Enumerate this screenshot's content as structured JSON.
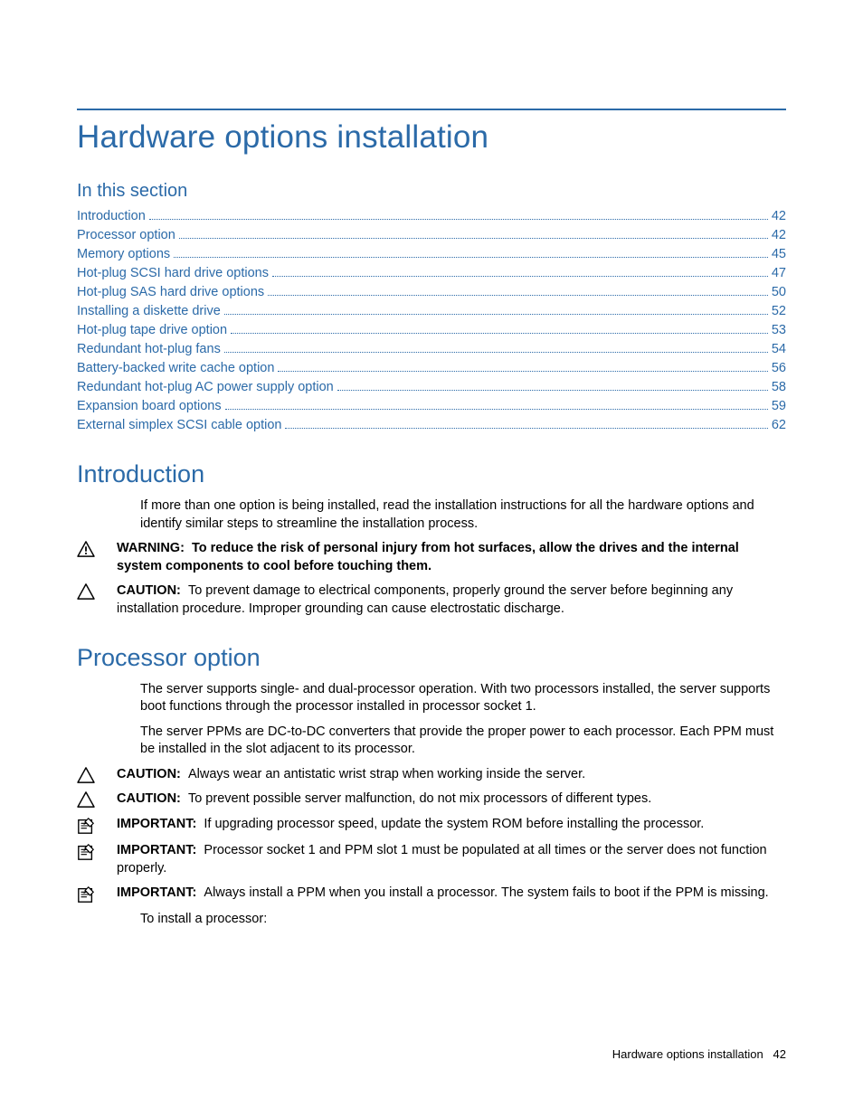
{
  "page_title": "Hardware options installation",
  "in_this_section_label": "In this section",
  "toc": [
    {
      "label": "Introduction",
      "page": "42"
    },
    {
      "label": "Processor option",
      "page": "42"
    },
    {
      "label": "Memory options",
      "page": "45"
    },
    {
      "label": "Hot-plug SCSI hard drive options",
      "page": "47"
    },
    {
      "label": "Hot-plug SAS hard drive options",
      "page": "50"
    },
    {
      "label": "Installing a diskette drive",
      "page": "52"
    },
    {
      "label": "Hot-plug tape drive option",
      "page": "53"
    },
    {
      "label": "Redundant hot-plug fans",
      "page": "54"
    },
    {
      "label": "Battery-backed write cache option",
      "page": "56"
    },
    {
      "label": "Redundant hot-plug AC power supply option",
      "page": "58"
    },
    {
      "label": "Expansion board options",
      "page": "59"
    },
    {
      "label": "External simplex SCSI cable option",
      "page": "62"
    }
  ],
  "introduction": {
    "heading": "Introduction",
    "body": "If more than one option is being installed, read the installation instructions for all the hardware options and identify similar steps to streamline the installation process.",
    "warning_label": "WARNING:",
    "warning_text": "To reduce the risk of personal injury from hot surfaces, allow the drives and the internal system components to cool before touching them.",
    "caution_label": "CAUTION:",
    "caution_text": "To prevent damage to electrical components, properly ground the server before beginning any installation procedure. Improper grounding can cause electrostatic discharge."
  },
  "processor": {
    "heading": "Processor option",
    "body1": "The server supports single- and dual-processor operation. With two processors installed, the server supports boot functions through the processor installed in processor socket 1.",
    "body2": "The server PPMs are DC-to-DC converters that provide the proper power to each processor. Each PPM must be installed in the slot adjacent to its processor.",
    "caution1_label": "CAUTION:",
    "caution1_text": "Always wear an antistatic wrist strap when working inside the server.",
    "caution2_label": "CAUTION:",
    "caution2_text": "To prevent possible server malfunction, do not mix processors of different types.",
    "important1_label": "IMPORTANT:",
    "important1_text": "If upgrading processor speed, update the system ROM before installing the processor.",
    "important2_label": "IMPORTANT:",
    "important2_text": "Processor socket 1 and PPM slot 1 must be populated at all times or the server does not function properly.",
    "important3_label": "IMPORTANT:",
    "important3_text": "Always install a PPM when you install a processor. The system fails to boot if the PPM is missing.",
    "install_lead": "To install a processor:"
  },
  "footer": {
    "text": "Hardware options installation",
    "page": "42"
  }
}
